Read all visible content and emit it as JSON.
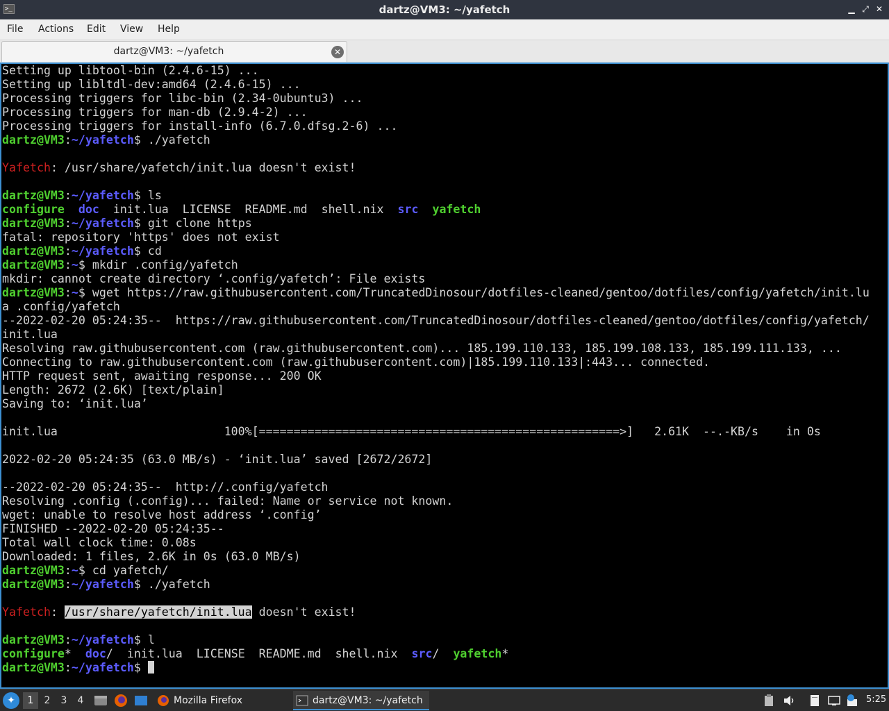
{
  "window": {
    "title": "dartz@VM3: ~/yafetch",
    "minimize": "▁",
    "maximize": "⤢",
    "close": "✕"
  },
  "menu": [
    "File",
    "Actions",
    "Edit",
    "View",
    "Help"
  ],
  "tab": {
    "label": "dartz@VM3: ~/yafetch",
    "close": "✕"
  },
  "terminal": {
    "lines": [
      [
        {
          "t": "Setting up libtool-bin (2.4.6-15) ..."
        }
      ],
      [
        {
          "t": "Setting up libltdl-dev:amd64 (2.4.6-15) ..."
        }
      ],
      [
        {
          "t": "Processing triggers for libc-bin (2.34-0ubuntu3) ..."
        }
      ],
      [
        {
          "t": "Processing triggers for man-db (2.9.4-2) ..."
        }
      ],
      [
        {
          "t": "Processing triggers for install-info (6.7.0.dfsg.2-6) ..."
        }
      ],
      [
        {
          "t": "dartz@VM3",
          "c": "g"
        },
        {
          "t": ":"
        },
        {
          "t": "~/yafetch",
          "c": "b"
        },
        {
          "t": "$ ./yafetch"
        }
      ],
      [
        {
          "t": ""
        }
      ],
      [
        {
          "t": "Yafetch",
          "c": "r"
        },
        {
          "t": ": /usr/share/yafetch/init.lua doesn't exist!"
        }
      ],
      [
        {
          "t": ""
        }
      ],
      [
        {
          "t": "dartz@VM3",
          "c": "g"
        },
        {
          "t": ":"
        },
        {
          "t": "~/yafetch",
          "c": "b"
        },
        {
          "t": "$ ls"
        }
      ],
      [
        {
          "t": "configure",
          "c": "dg"
        },
        {
          "t": "  "
        },
        {
          "t": "doc",
          "c": "b"
        },
        {
          "t": "  init.lua  LICENSE  README.md  shell.nix  "
        },
        {
          "t": "src",
          "c": "b"
        },
        {
          "t": "  "
        },
        {
          "t": "yafetch",
          "c": "dg"
        }
      ],
      [
        {
          "t": "dartz@VM3",
          "c": "g"
        },
        {
          "t": ":"
        },
        {
          "t": "~/yafetch",
          "c": "b"
        },
        {
          "t": "$ git clone https"
        }
      ],
      [
        {
          "t": "fatal: repository 'https' does not exist"
        }
      ],
      [
        {
          "t": "dartz@VM3",
          "c": "g"
        },
        {
          "t": ":"
        },
        {
          "t": "~/yafetch",
          "c": "b"
        },
        {
          "t": "$ cd"
        }
      ],
      [
        {
          "t": "dartz@VM3",
          "c": "g"
        },
        {
          "t": ":"
        },
        {
          "t": "~",
          "c": "b"
        },
        {
          "t": "$ mkdir .config/yafetch"
        }
      ],
      [
        {
          "t": "mkdir: cannot create directory ‘.config/yafetch’: File exists"
        }
      ],
      [
        {
          "t": "dartz@VM3",
          "c": "g"
        },
        {
          "t": ":"
        },
        {
          "t": "~",
          "c": "b"
        },
        {
          "t": "$ wget https://raw.githubusercontent.com/TruncatedDinosour/dotfiles-cleaned/gentoo/dotfiles/config/yafetch/init.lu"
        }
      ],
      [
        {
          "t": "a .config/yafetch"
        }
      ],
      [
        {
          "t": "--2022-02-20 05:24:35--  https://raw.githubusercontent.com/TruncatedDinosour/dotfiles-cleaned/gentoo/dotfiles/config/yafetch/"
        }
      ],
      [
        {
          "t": "init.lua"
        }
      ],
      [
        {
          "t": "Resolving raw.githubusercontent.com (raw.githubusercontent.com)... 185.199.110.133, 185.199.108.133, 185.199.111.133, ..."
        }
      ],
      [
        {
          "t": "Connecting to raw.githubusercontent.com (raw.githubusercontent.com)|185.199.110.133|:443... connected."
        }
      ],
      [
        {
          "t": "HTTP request sent, awaiting response... 200 OK"
        }
      ],
      [
        {
          "t": "Length: 2672 (2.6K) [text/plain]"
        }
      ],
      [
        {
          "t": "Saving to: ‘init.lua’"
        }
      ],
      [
        {
          "t": ""
        }
      ],
      [
        {
          "t": "init.lua                        100%[====================================================>]   2.61K  --.-KB/s    in 0s"
        }
      ],
      [
        {
          "t": ""
        }
      ],
      [
        {
          "t": "2022-02-20 05:24:35 (63.0 MB/s) - ‘init.lua’ saved [2672/2672]"
        }
      ],
      [
        {
          "t": ""
        }
      ],
      [
        {
          "t": "--2022-02-20 05:24:35--  http://.config/yafetch"
        }
      ],
      [
        {
          "t": "Resolving .config (.config)... failed: Name or service not known."
        }
      ],
      [
        {
          "t": "wget: unable to resolve host address ‘.config’"
        }
      ],
      [
        {
          "t": "FINISHED --2022-02-20 05:24:35--"
        }
      ],
      [
        {
          "t": "Total wall clock time: 0.08s"
        }
      ],
      [
        {
          "t": "Downloaded: 1 files, 2.6K in 0s (63.0 MB/s)"
        }
      ],
      [
        {
          "t": "dartz@VM3",
          "c": "g"
        },
        {
          "t": ":"
        },
        {
          "t": "~",
          "c": "b"
        },
        {
          "t": "$ cd yafetch/"
        }
      ],
      [
        {
          "t": "dartz@VM3",
          "c": "g"
        },
        {
          "t": ":"
        },
        {
          "t": "~/yafetch",
          "c": "b"
        },
        {
          "t": "$ ./yafetch"
        }
      ],
      [
        {
          "t": ""
        }
      ],
      [
        {
          "t": "Yafetch",
          "c": "r"
        },
        {
          "t": ": "
        },
        {
          "t": "/usr/share/yafetch/init.lua",
          "c": "hl"
        },
        {
          "t": " doesn't exist!"
        }
      ],
      [
        {
          "t": ""
        }
      ],
      [
        {
          "t": "dartz@VM3",
          "c": "g"
        },
        {
          "t": ":"
        },
        {
          "t": "~/yafetch",
          "c": "b"
        },
        {
          "t": "$ l"
        }
      ],
      [
        {
          "t": "configure",
          "c": "dg"
        },
        {
          "t": "*  "
        },
        {
          "t": "doc",
          "c": "b"
        },
        {
          "t": "/  init.lua  LICENSE  README.md  shell.nix  "
        },
        {
          "t": "src",
          "c": "b"
        },
        {
          "t": "/  "
        },
        {
          "t": "yafetch",
          "c": "dg"
        },
        {
          "t": "*"
        }
      ],
      [
        {
          "t": "dartz@VM3",
          "c": "g"
        },
        {
          "t": ":"
        },
        {
          "t": "~/yafetch",
          "c": "b"
        },
        {
          "t": "$ "
        },
        {
          "t": "",
          "c": "cursor"
        }
      ]
    ]
  },
  "taskbar": {
    "workspaces": [
      "1",
      "2",
      "3",
      "4"
    ],
    "active_workspace": "1",
    "tasks": [
      {
        "label": "Mozilla Firefox",
        "icon": "firefox-icon"
      },
      {
        "label": "dartz@VM3: ~/yafetch",
        "icon": "terminal-icon"
      }
    ],
    "clock": "5:25",
    "tray_badge": "!"
  },
  "colors": {
    "prompt_user": "#4fcf2f",
    "prompt_path": "#5c5cff",
    "error_red": "#cd2020",
    "terminal_bg": "#000000",
    "terminal_fg": "#d3d3d3",
    "focus_border": "#3d8fd1"
  }
}
